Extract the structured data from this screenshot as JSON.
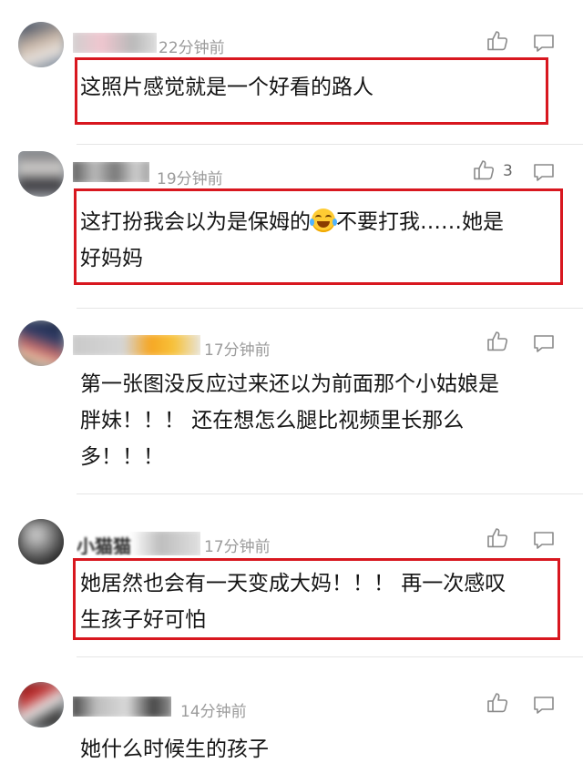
{
  "comments": [
    {
      "time": "22分钟前",
      "like_count": "",
      "text": "这照片感觉就是一个好看的路人",
      "highlighted": true
    },
    {
      "time": "19分钟前",
      "like_count": "3",
      "text_before": "这打扮我会以为是保姆的",
      "emoji": "face-with-tears-of-joy",
      "text_after": "不要打我……她是\n好妈妈",
      "highlighted": true
    },
    {
      "time": "17分钟前",
      "like_count": "",
      "text": "第一张图没反应过来还以为前面那个小姑娘是\n胖妹！！！ 还在想怎么腿比视频里长那么\n多！！！",
      "highlighted": false
    },
    {
      "time": "17分钟前",
      "like_count": "",
      "name_visible_fragment": "小猫猫",
      "text": "她居然也会有一天变成大妈！！！ 再一次感叹\n生孩子好可怕",
      "highlighted": true
    },
    {
      "time": "14分钟前",
      "like_count": "",
      "text": "她什么时候生的孩子",
      "highlighted": false
    }
  ],
  "icons": {
    "like": "thumbs-up-icon",
    "reply": "comment-bubble-icon"
  },
  "colors": {
    "highlight_box": "#d8171f",
    "timestamp": "#9b9b9b",
    "icon_stroke": "#8a8a8a"
  }
}
